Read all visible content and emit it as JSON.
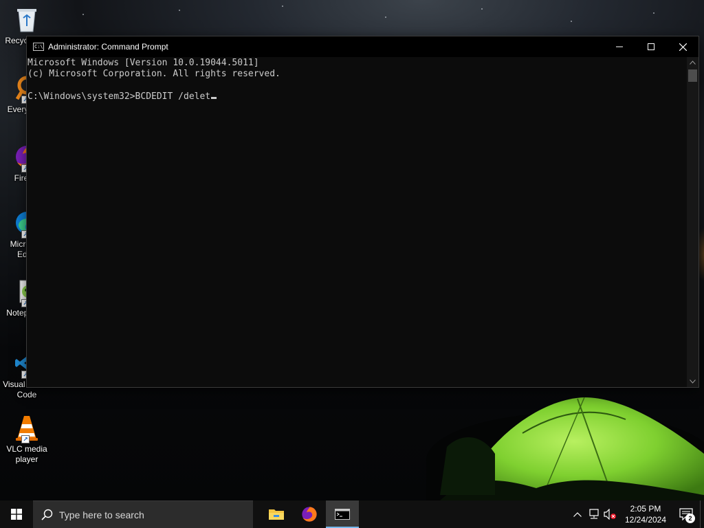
{
  "desktop": {
    "icons": [
      {
        "label": "Recycle Bin",
        "icon": "recycle-bin-icon"
      },
      {
        "label": "Everything",
        "icon": "everything-search-icon"
      },
      {
        "label": "Firefox",
        "icon": "firefox-icon"
      },
      {
        "label": "Microsoft Edge",
        "icon": "edge-icon"
      },
      {
        "label": "Notepad++",
        "icon": "notepad-plus-plus-icon"
      },
      {
        "label": "Visual Studio Code",
        "icon": "vscode-icon"
      },
      {
        "label": "VLC media player",
        "icon": "vlc-icon"
      }
    ]
  },
  "window": {
    "title": "Administrator: Command Prompt",
    "icon_text": "C:\\",
    "controls": {
      "minimize": "minimize-icon",
      "maximize": "maximize-icon",
      "close": "close-icon"
    },
    "console": {
      "line1": "Microsoft Windows [Version 10.0.19044.5011]",
      "line2": "(c) Microsoft Corporation. All rights reserved.",
      "line3": "",
      "prompt": "C:\\Windows\\system32>",
      "command": "BCDEDIT /delet"
    }
  },
  "taskbar": {
    "search_placeholder": "Type here to search",
    "apps": [
      {
        "name": "File Explorer",
        "icon": "folder-icon",
        "active": false
      },
      {
        "name": "Firefox",
        "icon": "firefox-icon",
        "active": false
      },
      {
        "name": "Command Prompt",
        "icon": "terminal-icon",
        "active": true
      }
    ],
    "time": "2:05 PM",
    "date": "12/24/2024",
    "notification_count": "2"
  },
  "colors": {
    "console_bg": "#0c0c0c",
    "console_text": "#cccccc",
    "taskbar_bg": "#101010",
    "accent": "#76b9ed"
  }
}
